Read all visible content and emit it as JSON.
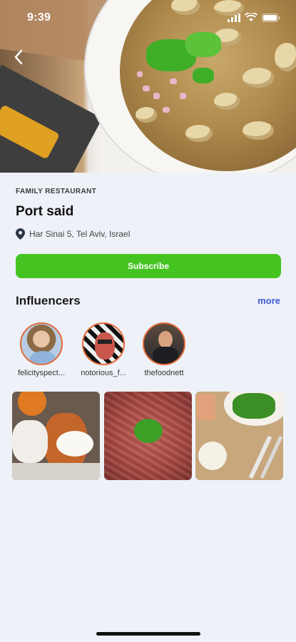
{
  "status_bar": {
    "time": "9:39"
  },
  "header": {
    "back_icon": "chevron-left-icon"
  },
  "restaurant": {
    "category": "FAMILY RESTAURANT",
    "name": "Port said",
    "address": "Har Sinai 5, Tel Aviv, Israel",
    "address_icon": "location-pin-icon"
  },
  "actions": {
    "subscribe_label": "Subscribe",
    "accent_color": "#45c421"
  },
  "influencers": {
    "title": "Influencers",
    "more_label": "more",
    "items": [
      {
        "username": "felicityspect..."
      },
      {
        "username": "notorious_f..."
      },
      {
        "username": "thefoodnett"
      }
    ]
  }
}
